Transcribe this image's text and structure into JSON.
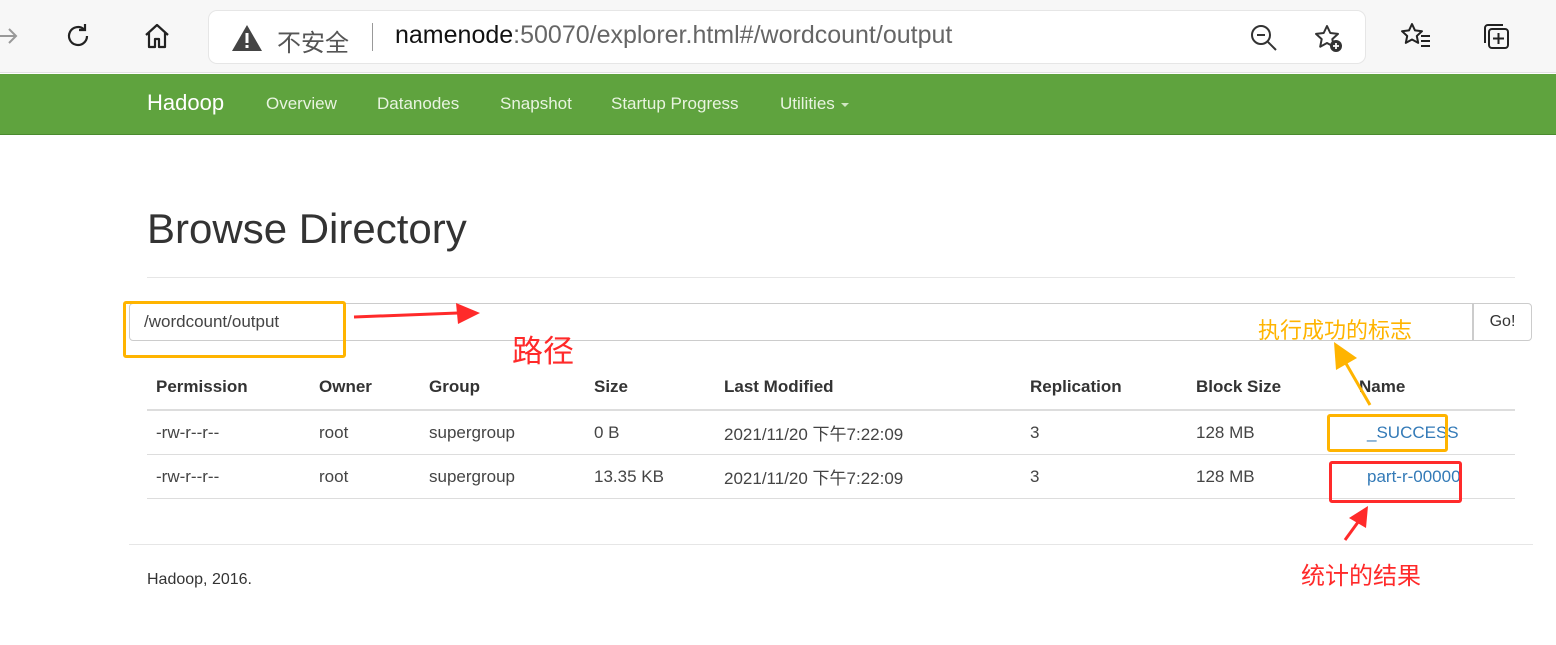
{
  "browser": {
    "security_label": "不安全",
    "url_host": "namenode",
    "url_rest": ":50070/explorer.html#/wordcount/output"
  },
  "navbar": {
    "brand": "Hadoop",
    "items": [
      "Overview",
      "Datanodes",
      "Snapshot",
      "Startup Progress",
      "Utilities"
    ]
  },
  "page": {
    "title": "Browse Directory",
    "path_value": "/wordcount/output",
    "go_label": "Go!"
  },
  "table": {
    "headers": [
      "Permission",
      "Owner",
      "Group",
      "Size",
      "Last Modified",
      "Replication",
      "Block Size",
      "Name"
    ],
    "rows": [
      [
        "-rw-r--r--",
        "root",
        "supergroup",
        "0 B",
        "2021/11/20 下午7:22:09",
        "3",
        "128 MB",
        "_SUCCESS"
      ],
      [
        "-rw-r--r--",
        "root",
        "supergroup",
        "13.35 KB",
        "2021/11/20 下午7:22:09",
        "3",
        "128 MB",
        "part-r-00000"
      ]
    ]
  },
  "footer": "Hadoop, 2016.",
  "annotations": {
    "path_label": "路径",
    "success_label": "执行成功的标志",
    "result_label": "统计的结果",
    "colors": {
      "red": "#ff2a2a",
      "orange": "#ffb400",
      "nav_green": "#5fa33e"
    }
  }
}
